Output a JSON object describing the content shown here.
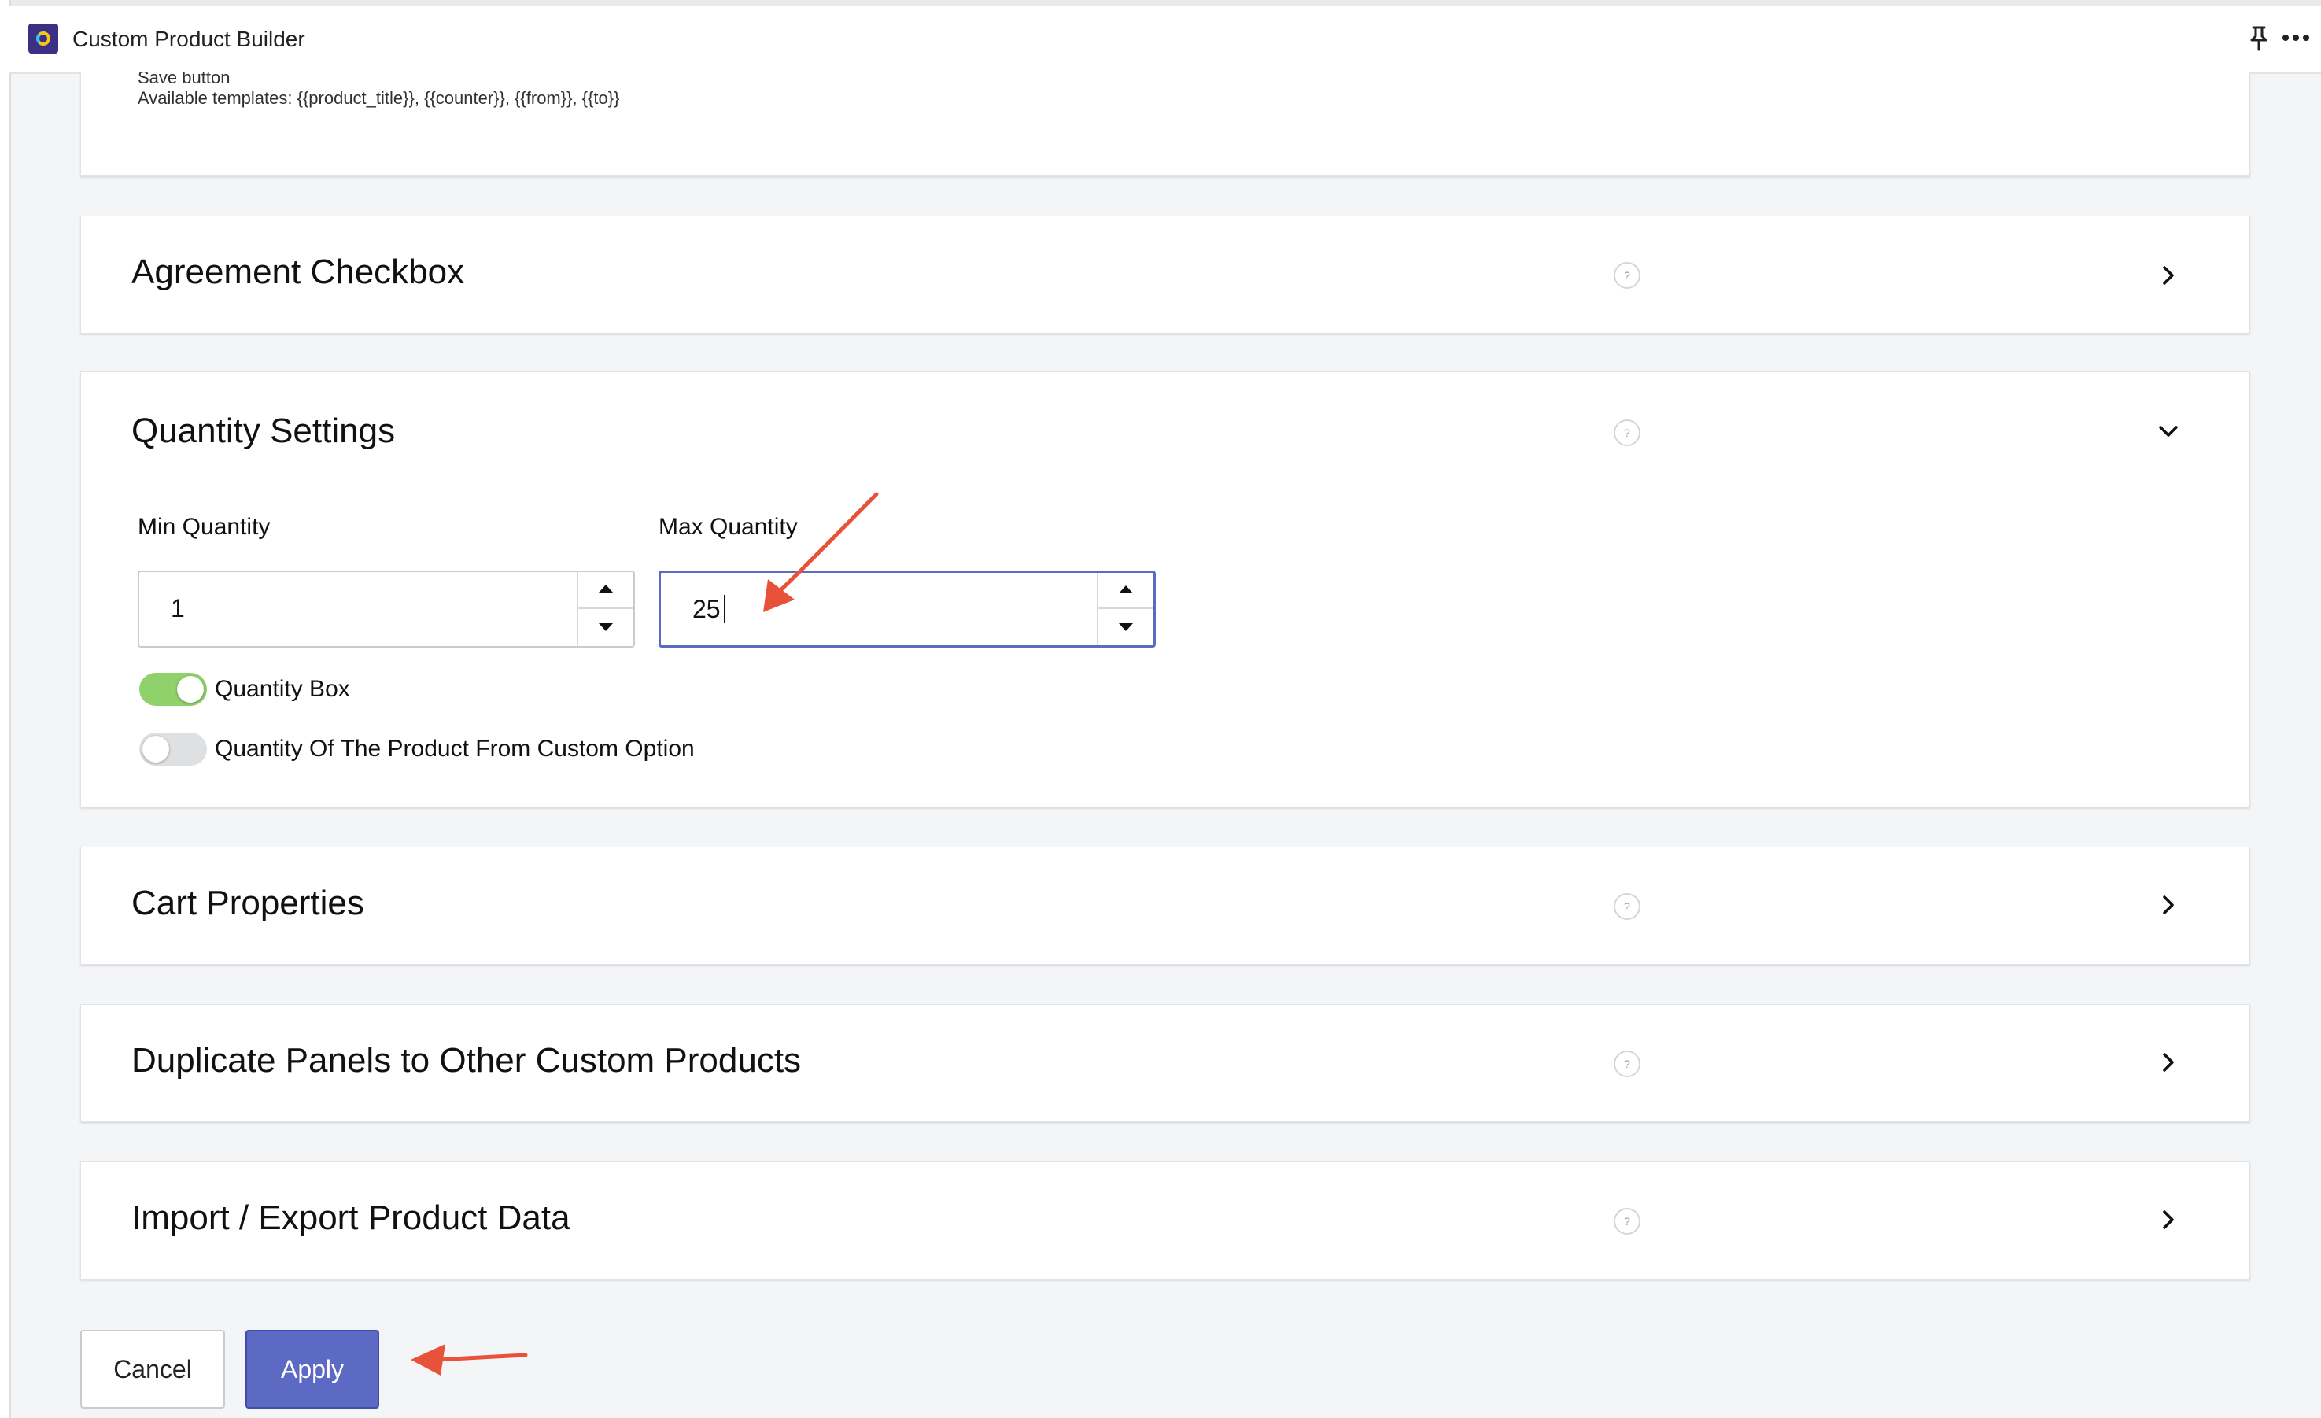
{
  "app": {
    "title": "Custom Product Builder"
  },
  "top_panel": {
    "cut_label": "Save button",
    "templates_note": "Available templates: {{product_title}}, {{counter}}, {{from}}, {{to}}"
  },
  "panels": {
    "agreement": {
      "title": "Agreement Checkbox",
      "help": "?"
    },
    "quantity": {
      "title": "Quantity Settings",
      "help": "?",
      "min_label": "Min Quantity",
      "min_value": "1",
      "max_label": "Max Quantity",
      "max_value": "25",
      "toggles": [
        {
          "label": "Quantity Box",
          "on": true
        },
        {
          "label": "Quantity Of The Product From Custom Option",
          "on": false
        }
      ]
    },
    "cart": {
      "title": "Cart Properties",
      "help": "?"
    },
    "duplicate": {
      "title": "Duplicate Panels to Other Custom Products",
      "help": "?"
    },
    "import_export": {
      "title": "Import / Export Product Data",
      "help": "?"
    }
  },
  "actions": {
    "cancel": "Cancel",
    "apply": "Apply"
  },
  "colors": {
    "accent": "#5c6ac4",
    "toggle_on": "#8fd16b",
    "annotation": "#e8513a"
  },
  "icons": [
    "app-logo-icon",
    "pin-icon",
    "more-icon",
    "help-icon",
    "chevron-right-icon",
    "chevron-down-icon",
    "arrow-up-icon",
    "arrow-down-icon"
  ]
}
